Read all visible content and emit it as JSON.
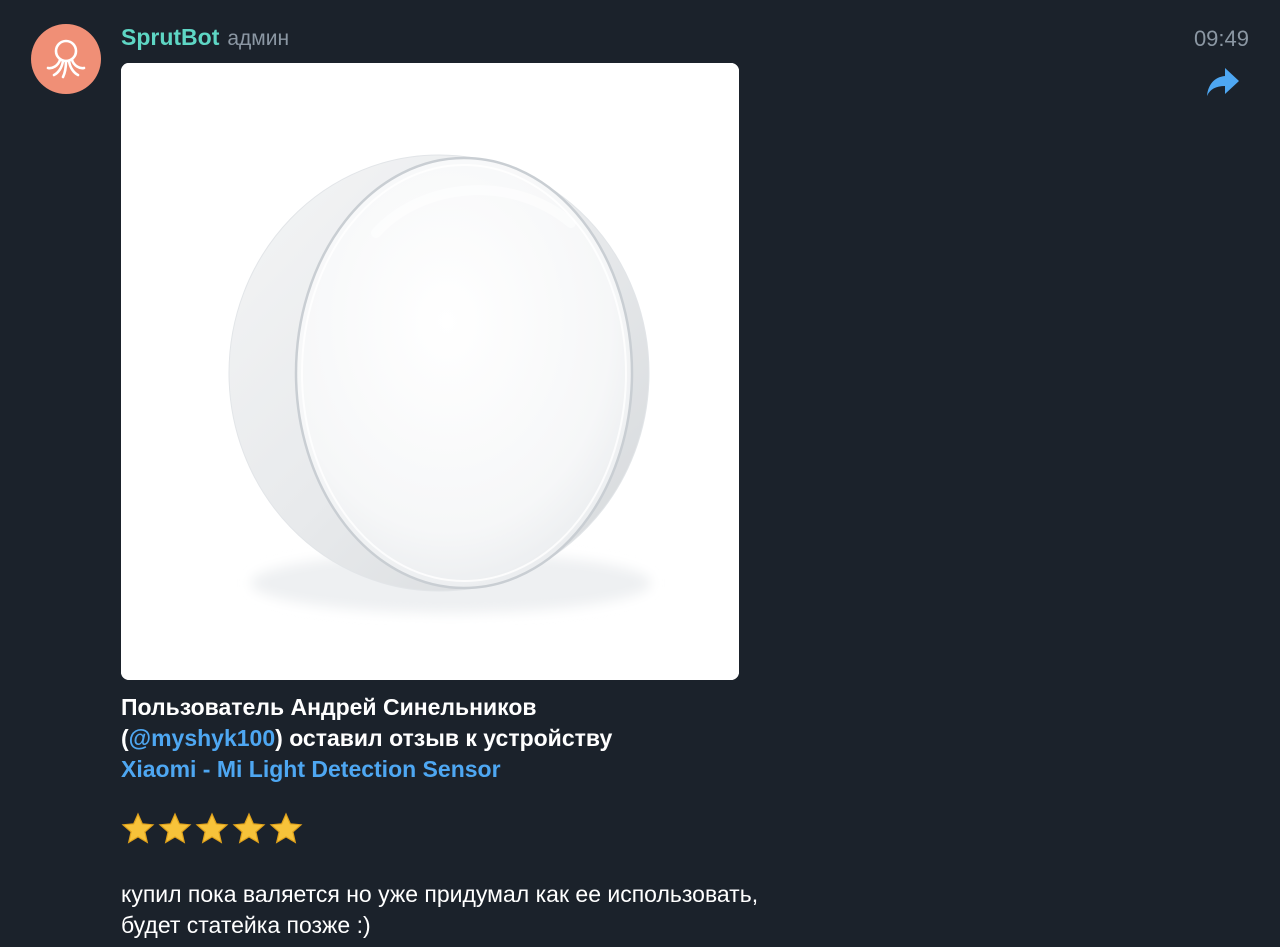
{
  "message": {
    "sender": "SprutBot",
    "role": "админ",
    "time": "09:49",
    "avatar_icon": "octopus-icon",
    "forward_icon": "forward-arrow-icon",
    "text": {
      "line1_prefix": "Пользователь Андрей Синельников",
      "open_paren": "(",
      "mention": "@myshyk100",
      "close_part": ") оставил отзыв к устройству",
      "device_link": "Xiaomi - Mi Light Detection Sensor"
    },
    "rating": {
      "stars": 5,
      "max": 5,
      "icon": "star-icon"
    },
    "review": "купил пока валяется но уже придумал как ее использовать, будет статейка позже :)"
  },
  "colors": {
    "background": "#1b222b",
    "sender": "#5ed6c4",
    "link": "#4ea7f2",
    "meta": "#8b97a3",
    "avatar": "#f08f76",
    "forward": "#4ea7f2"
  }
}
